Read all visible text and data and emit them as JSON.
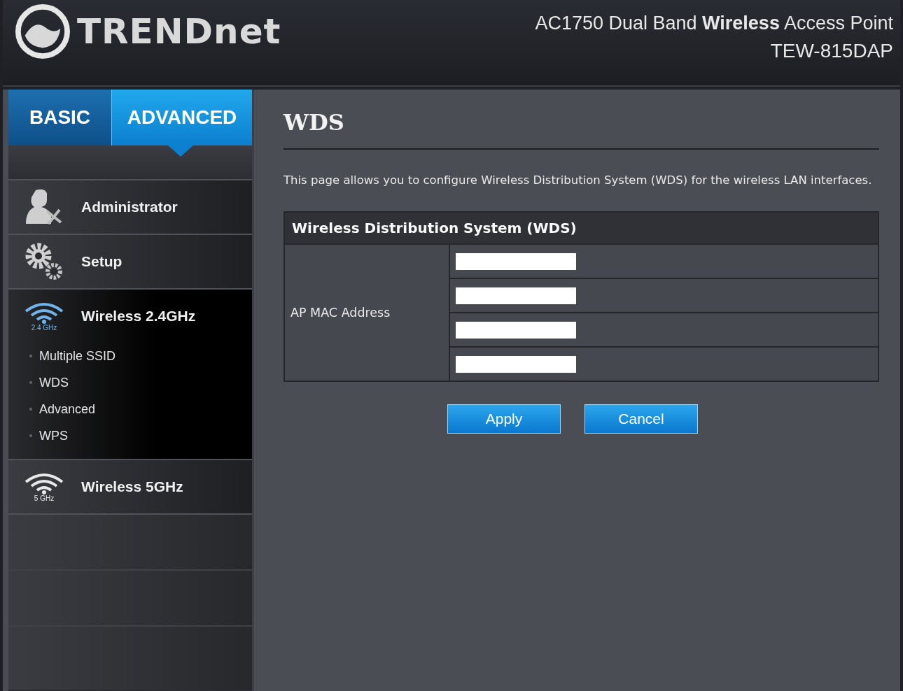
{
  "header": {
    "brand": "TRENDnet",
    "product": "AC1750 Dual Band **Wireless** Access Point",
    "model": "TEW-815DAP"
  },
  "tabs": [
    {
      "label": "BASIC",
      "selected": false
    },
    {
      "label": "ADVANCED",
      "selected": true
    }
  ],
  "sidebar": {
    "items": [
      {
        "label": "Administrator",
        "kind": "admin",
        "expanded": false
      },
      {
        "label": "Setup",
        "kind": "gears",
        "expanded": false
      },
      {
        "label": "Wireless 2.4GHz",
        "kind": "wifi",
        "icon_caption": "2.4 GHz",
        "expanded": true,
        "children": [
          {
            "label": "Multiple SSID"
          },
          {
            "label": "WDS"
          },
          {
            "label": "Advanced"
          },
          {
            "label": "WPS"
          }
        ]
      },
      {
        "label": "Wireless 5GHz",
        "kind": "wifi",
        "icon_caption": "5 GHz",
        "expanded": false
      }
    ]
  },
  "page": {
    "title": "WDS",
    "description": "This page allows you to configure Wireless Distribution System (WDS) for the wireless LAN interfaces.",
    "table": {
      "title": "Wireless Distribution System (WDS)",
      "label": "AP MAC Address",
      "fields": [
        {
          "kind": "text"
        },
        {
          "kind": "text"
        },
        {
          "kind": "text"
        },
        {
          "kind": "text"
        }
      ]
    },
    "buttons": [
      "Apply",
      "Cancel"
    ]
  }
}
